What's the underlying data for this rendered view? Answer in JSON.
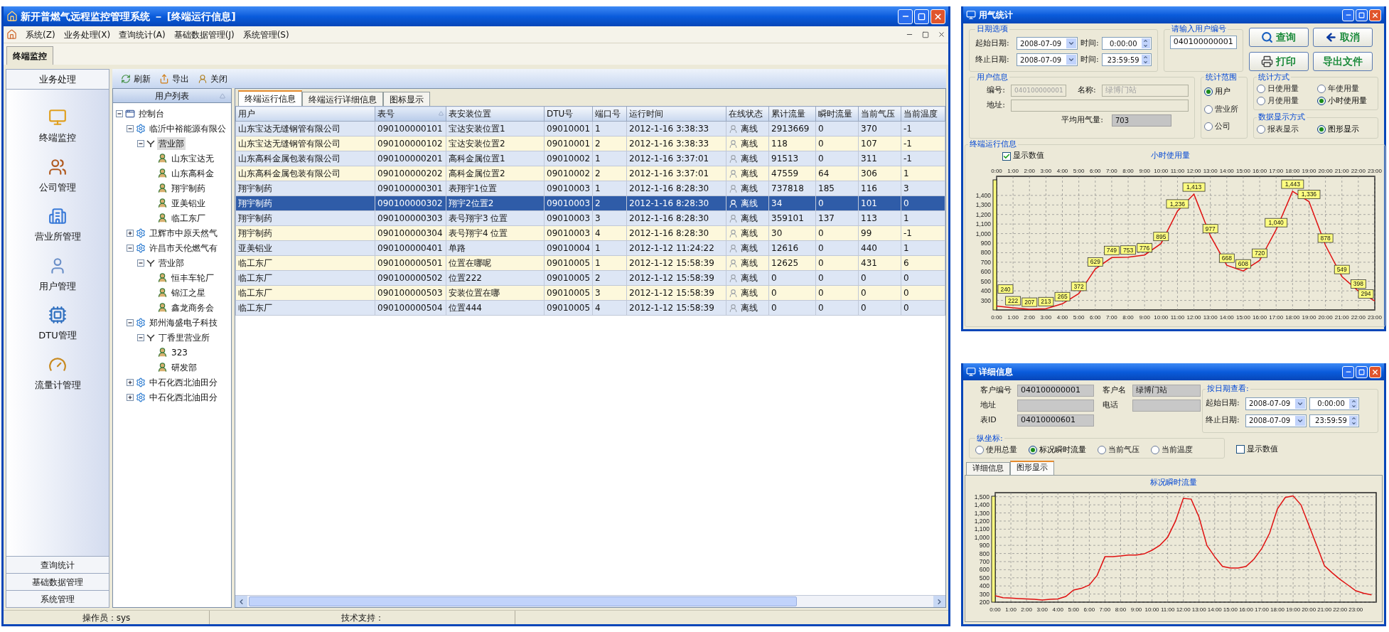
{
  "main_window": {
    "title": "新开普燃气远程监控管理系统 － [终端运行信息]",
    "menu": [
      "系统(Z)",
      "业务处理(X)",
      "查询统计(A)",
      "基础数据管理(J)",
      "系统管理(S)"
    ],
    "doc_tabs": [
      {
        "label": "终端监控",
        "selected": true
      }
    ],
    "sidebar": {
      "header": "业务处理",
      "items": [
        {
          "label": "终端监控",
          "kind": "monitor",
          "selected": false
        },
        {
          "label": "公司管理",
          "kind": "company",
          "selected": false
        },
        {
          "label": "营业所管理",
          "kind": "office",
          "selected": false
        },
        {
          "label": "用户管理",
          "kind": "user",
          "selected": false
        },
        {
          "label": "DTU管理",
          "kind": "dtu",
          "selected": false
        },
        {
          "label": "流量计管理",
          "kind": "meter",
          "selected": false
        }
      ],
      "sections": [
        "查询统计",
        "基础数据管理",
        "系统管理"
      ]
    },
    "toolbar": [
      {
        "label": "刷新",
        "kind": "refresh"
      },
      {
        "label": "导出",
        "kind": "export"
      },
      {
        "label": "关闭",
        "kind": "close"
      }
    ],
    "tree": {
      "header": "用户列表",
      "nodes": [
        {
          "label": "控制台",
          "kind": "console",
          "expanded": true,
          "selected": false,
          "children": [
            {
              "label": "临沂中裕能源有限公",
              "kind": "company",
              "expanded": true,
              "selected": false,
              "children": [
                {
                  "label": "营业部",
                  "kind": "office",
                  "expanded": true,
                  "selected": true,
                  "children": [
                    {
                      "label": "山东宝达无",
                      "kind": "user",
                      "selected": false
                    },
                    {
                      "label": "山东高科金",
                      "kind": "user",
                      "selected": false
                    },
                    {
                      "label": "翔宇制药",
                      "kind": "user",
                      "selected": false
                    },
                    {
                      "label": "亚美铝业",
                      "kind": "user",
                      "selected": false
                    },
                    {
                      "label": "临工东厂",
                      "kind": "user",
                      "selected": false
                    }
                  ]
                }
              ]
            },
            {
              "label": "卫辉市中原天然气",
              "kind": "company",
              "expanded": false,
              "selected": false
            },
            {
              "label": "许昌市天伦燃气有",
              "kind": "company",
              "expanded": true,
              "selected": false,
              "children": [
                {
                  "label": "营业部",
                  "kind": "office",
                  "expanded": true,
                  "selected": false,
                  "children": [
                    {
                      "label": "恒丰车轮厂",
                      "kind": "user",
                      "selected": false
                    },
                    {
                      "label": "锦江之星",
                      "kind": "user",
                      "selected": false
                    },
                    {
                      "label": "鑫龙商务会",
                      "kind": "user",
                      "selected": false
                    }
                  ]
                }
              ]
            },
            {
              "label": "郑州海盛电子科技",
              "kind": "company",
              "expanded": true,
              "selected": false,
              "children": [
                {
                  "label": "丁香里营业所",
                  "kind": "office",
                  "expanded": true,
                  "selected": false,
                  "children": [
                    {
                      "label": "323",
                      "kind": "user",
                      "selected": false
                    },
                    {
                      "label": "研发部",
                      "kind": "user",
                      "selected": false
                    }
                  ]
                }
              ]
            },
            {
              "label": "中石化西北油田分",
              "kind": "company",
              "expanded": false,
              "selected": false
            },
            {
              "label": "中石化西北油田分",
              "kind": "company",
              "expanded": false,
              "selected": false
            }
          ]
        }
      ]
    },
    "tabs": [
      {
        "label": "终端运行信息",
        "selected": true
      },
      {
        "label": "终端运行详细信息",
        "selected": false
      },
      {
        "label": "图标显示",
        "selected": false
      }
    ],
    "table": {
      "columns": [
        {
          "label": "用户",
          "kind": "text",
          "sorted": false
        },
        {
          "label": "表号",
          "kind": "text",
          "sorted": true
        },
        {
          "label": "表安装位置",
          "kind": "text",
          "sorted": false
        },
        {
          "label": "DTU号",
          "kind": "text",
          "sorted": false
        },
        {
          "label": "端口号",
          "kind": "text",
          "sorted": false
        },
        {
          "label": "运行时间",
          "kind": "text",
          "sorted": false
        },
        {
          "label": "在线状态",
          "kind": "status",
          "sorted": false
        },
        {
          "label": "累计流量",
          "kind": "text",
          "sorted": false
        },
        {
          "label": "瞬时流量",
          "kind": "text",
          "sorted": false
        },
        {
          "label": "当前气压",
          "kind": "text",
          "sorted": false
        },
        {
          "label": "当前温度",
          "kind": "text",
          "sorted": false
        }
      ],
      "rows": [
        {
          "selected": false,
          "cells": [
            "山东宝达无缝钢管有限公司",
            "090100000101",
            "宝达安装位置1",
            "09010001",
            "1",
            "2012-1-16 3:38:33",
            "离线",
            "2913669",
            "0",
            "370",
            "-1"
          ]
        },
        {
          "selected": false,
          "cells": [
            "山东宝达无缝钢管有限公司",
            "090100000102",
            "宝达安装位置2",
            "09010001",
            "2",
            "2012-1-16 3:38:33",
            "离线",
            "118",
            "0",
            "107",
            "-1"
          ]
        },
        {
          "selected": false,
          "cells": [
            "山东高科金属包装有限公司",
            "090100000201",
            "高科金属位置1",
            "09010002",
            "1",
            "2012-1-16 3:37:01",
            "离线",
            "91513",
            "0",
            "311",
            "-1"
          ]
        },
        {
          "selected": false,
          "cells": [
            "山东高科金属包装有限公司",
            "090100000202",
            "高科金属位置2",
            "09010002",
            "2",
            "2012-1-16 3:37:01",
            "离线",
            "47559",
            "64",
            "306",
            "1"
          ]
        },
        {
          "selected": false,
          "cells": [
            "翔宇制药",
            "090100000301",
            "表翔宇1位置",
            "09010003",
            "1",
            "2012-1-16 8:28:30",
            "离线",
            "737818",
            "185",
            "116",
            "3"
          ]
        },
        {
          "selected": true,
          "cells": [
            "翔宇制药",
            "090100000302",
            "翔宇2位置2",
            "09010003",
            "2",
            "2012-1-16 8:28:30",
            "离线",
            "34",
            "0",
            "101",
            "0"
          ]
        },
        {
          "selected": false,
          "cells": [
            "翔宇制药",
            "090100000303",
            "表号翔宇3 位置",
            "09010003",
            "3",
            "2012-1-16 8:28:30",
            "离线",
            "359101",
            "137",
            "113",
            "1"
          ]
        },
        {
          "selected": false,
          "cells": [
            "翔宇制药",
            "090100000304",
            "表号翔宇4 位置",
            "09010003",
            "4",
            "2012-1-16 8:28:30",
            "离线",
            "30",
            "0",
            "99",
            "-1"
          ]
        },
        {
          "selected": false,
          "cells": [
            "亚美铝业",
            "090100000401",
            "单路",
            "09010004",
            "1",
            "2012-1-12 11:24:22",
            "离线",
            "12616",
            "0",
            "440",
            "1"
          ]
        },
        {
          "selected": false,
          "cells": [
            "临工东厂",
            "090100000501",
            "位置在哪呢",
            "09010005",
            "1",
            "2012-1-12 15:58:39",
            "离线",
            "12625",
            "0",
            "431",
            "6"
          ]
        },
        {
          "selected": false,
          "cells": [
            "临工东厂",
            "090100000502",
            "位置222",
            "09010005",
            "2",
            "2012-1-12 15:58:39",
            "离线",
            "0",
            "0",
            "0",
            "0"
          ]
        },
        {
          "selected": false,
          "cells": [
            "临工东厂",
            "090100000503",
            "安装位置在哪",
            "09010005",
            "3",
            "2012-1-12 15:58:39",
            "离线",
            "0",
            "0",
            "0",
            "0"
          ]
        },
        {
          "selected": false,
          "cells": [
            "临工东厂",
            "090100000504",
            "位置444",
            "09010005",
            "4",
            "2012-1-12 15:58:39",
            "离线",
            "0",
            "0",
            "0",
            "0"
          ]
        }
      ]
    },
    "status_bar": [
      "操作员：sys",
      "技术支持："
    ]
  },
  "stats_window": {
    "title": "用气统计",
    "date_group": {
      "title": "日期选项",
      "rows": [
        {
          "label": "起始日期:",
          "date": "2008-07-09",
          "time_label": "时间:",
          "time": "0:00:00"
        },
        {
          "label": "终止日期:",
          "date": "2008-07-09",
          "time_label": "时间:",
          "time": "23:59:59"
        }
      ]
    },
    "user_code_group": {
      "title": "请输入用户编号",
      "value": "040100000001"
    },
    "buttons": [
      {
        "label": "查询",
        "kind": "search"
      },
      {
        "label": "取消",
        "kind": "back"
      },
      {
        "label": "打印",
        "kind": "print"
      },
      {
        "label": "导出文件",
        "kind": "plain"
      }
    ],
    "user_info": {
      "title": "用户信息",
      "code_label": "编号:",
      "code": "040100000001",
      "name_label": "名称:",
      "name": "绿博门站",
      "address_label": "地址:",
      "avg_label": "平均用气量:",
      "avg": "703"
    },
    "scope": {
      "title": "统计范围",
      "options": [
        {
          "label": "用户",
          "selected": true
        },
        {
          "label": "营业所",
          "selected": false
        },
        {
          "label": "公司",
          "selected": false
        }
      ]
    },
    "method": {
      "title": "统计方式",
      "options": [
        {
          "label": "日使用量",
          "selected": false
        },
        {
          "label": "年使用量",
          "selected": false
        },
        {
          "label": "月使用量",
          "selected": false
        },
        {
          "label": "小时使用量",
          "selected": true
        }
      ]
    },
    "display": {
      "title": "数据显示方式",
      "options": [
        {
          "label": "报表显示",
          "selected": false
        },
        {
          "label": "图形显示",
          "selected": true
        }
      ]
    },
    "run_info": {
      "title": "终端运行信息",
      "show_values": {
        "label": "显示数值",
        "checked": true
      },
      "top_axis_labels": [
        "0:00",
        "1:00",
        "2:00",
        "3:00",
        "4:00",
        "5:00",
        "6:00",
        "7:00",
        "8:00",
        "9:00",
        "10:00",
        "11:00",
        "12:00",
        "13:00",
        "14:00",
        "15:00",
        "16:00",
        "17:00",
        "18:00",
        "19:00",
        "20:00",
        "21:00",
        "22:00",
        "23:00"
      ],
      "chart_data": {
        "type": "line",
        "title": "小时使用量",
        "categories": [
          "0:00",
          "1:00",
          "2:00",
          "3:00",
          "4:00",
          "5:00",
          "6:00",
          "7:00",
          "8:00",
          "9:00",
          "10:00",
          "11:00",
          "12:00",
          "13:00",
          "14:00",
          "15:00",
          "16:00",
          "17:00",
          "18:00",
          "19:00",
          "20:00",
          "21:00",
          "22:00",
          "23:00"
        ],
        "values": [
          240,
          222,
          207,
          213,
          265,
          372,
          629,
          749,
          753,
          776,
          895,
          1236,
          1413,
          977,
          668,
          608,
          720,
          1040,
          1443,
          1336,
          878,
          549,
          398,
          294
        ],
        "value_labels": [
          "240",
          "222",
          "207",
          "213",
          "265",
          "372",
          "629",
          "749",
          "753",
          "776",
          "895",
          "1,236",
          "1,413",
          "977",
          "668",
          "608",
          "720",
          "1,040",
          "1,443",
          "1,336",
          "878",
          "549",
          "398",
          "294"
        ],
        "ylim": [
          200,
          1600
        ],
        "grid": true,
        "yticks": [
          300,
          400,
          500,
          600,
          700,
          800,
          900,
          {
            "value": 1000,
            "label": "1,000"
          },
          {
            "value": 1100,
            "label": "1,100"
          },
          {
            "value": 1200,
            "label": "1,200"
          },
          {
            "value": 1300,
            "label": "1,300"
          },
          {
            "value": 1400,
            "label": "1,400"
          }
        ]
      }
    }
  },
  "detail_window": {
    "title": "详细信息",
    "fields": [
      {
        "label": "客户编号",
        "value": "040100000001"
      },
      {
        "label": "客户名",
        "value": "绿博门站"
      },
      {
        "label": "地址"
      },
      {
        "label": "电话"
      },
      {
        "label": "表ID",
        "value": "04010000601"
      }
    ],
    "y_axis_group": {
      "title": "纵坐标:",
      "options": [
        {
          "label": "使用总量",
          "selected": false
        },
        {
          "label": "标况瞬时流量",
          "selected": true
        },
        {
          "label": "当前气压",
          "selected": false
        },
        {
          "label": "当前温度",
          "selected": false
        }
      ]
    },
    "show_values": {
      "label": "显示数值",
      "checked": false
    },
    "date_group": {
      "title": "按日期查看:",
      "rows": [
        {
          "label": "起始日期:",
          "date": "2008-07-09",
          "time": "0:00:00"
        },
        {
          "label": "终止日期:",
          "date": "2008-07-09",
          "time": "23:59:59"
        }
      ]
    },
    "tabs": [
      {
        "label": "详细信息",
        "selected": false
      },
      {
        "label": "图形显示",
        "selected": true
      }
    ],
    "chart_data": {
      "type": "line",
      "title": "标况瞬时流量",
      "x": [
        0,
        0.5,
        1,
        1.5,
        2,
        2.5,
        3,
        3.5,
        4,
        4.5,
        5,
        5.5,
        6,
        6.5,
        7,
        7.5,
        8,
        8.5,
        9,
        9.5,
        10,
        10.5,
        11,
        11.5,
        12,
        12.5,
        13,
        13.5,
        14,
        14.5,
        15,
        15.5,
        16,
        16.5,
        17,
        17.5,
        18,
        18.5,
        19,
        19.5,
        20,
        20.5,
        21,
        21.5,
        22,
        22.5,
        23,
        23.5,
        24
      ],
      "values": [
        280,
        255,
        250,
        245,
        240,
        235,
        225,
        235,
        240,
        270,
        350,
        370,
        410,
        530,
        760,
        760,
        770,
        780,
        780,
        795,
        840,
        900,
        1000,
        1200,
        1480,
        1470,
        1250,
        900,
        760,
        640,
        620,
        620,
        640,
        730,
        860,
        1050,
        1350,
        1490,
        1510,
        1400,
        1150,
        900,
        650,
        560,
        480,
        410,
        340,
        310,
        290
      ],
      "xlim": [
        0,
        24.3
      ],
      "ylim": [
        200,
        1550
      ],
      "grid": true,
      "xticks": [
        {
          "value": 0,
          "label": "0:00"
        },
        {
          "value": 1,
          "label": "1:00"
        },
        {
          "value": 2,
          "label": "2:00"
        },
        {
          "value": 3,
          "label": "3:00"
        },
        {
          "value": 4,
          "label": "4:00"
        },
        {
          "value": 5,
          "label": "5:00"
        },
        {
          "value": 6,
          "label": "6:00"
        },
        {
          "value": 7,
          "label": "7:00"
        },
        {
          "value": 8,
          "label": "8:00"
        },
        {
          "value": 9,
          "label": "9:00"
        },
        {
          "value": 10,
          "label": "10:00"
        },
        {
          "value": 11,
          "label": "11:00"
        },
        {
          "value": 12,
          "label": "12:00"
        },
        {
          "value": 13,
          "label": "13:00"
        },
        {
          "value": 14,
          "label": "14:00"
        },
        {
          "value": 15,
          "label": "15:00"
        },
        {
          "value": 16,
          "label": "16:00"
        },
        {
          "value": 17,
          "label": "17:00"
        },
        {
          "value": 18,
          "label": "18:00"
        },
        {
          "value": 19,
          "label": "19:00"
        },
        {
          "value": 20,
          "label": "20:00"
        },
        {
          "value": 21,
          "label": "21:00"
        },
        {
          "value": 22,
          "label": "22:00"
        },
        {
          "value": 23,
          "label": "23:00"
        }
      ],
      "yticks": [
        200,
        300,
        400,
        500,
        600,
        700,
        800,
        900,
        {
          "value": 1000,
          "label": "1,000"
        },
        {
          "value": 1100,
          "label": "1,100"
        },
        {
          "value": 1200,
          "label": "1,200"
        },
        {
          "value": 1300,
          "label": "1,300"
        },
        {
          "value": 1400,
          "label": "1,400"
        },
        {
          "value": 1500,
          "label": "1,500"
        }
      ]
    }
  }
}
